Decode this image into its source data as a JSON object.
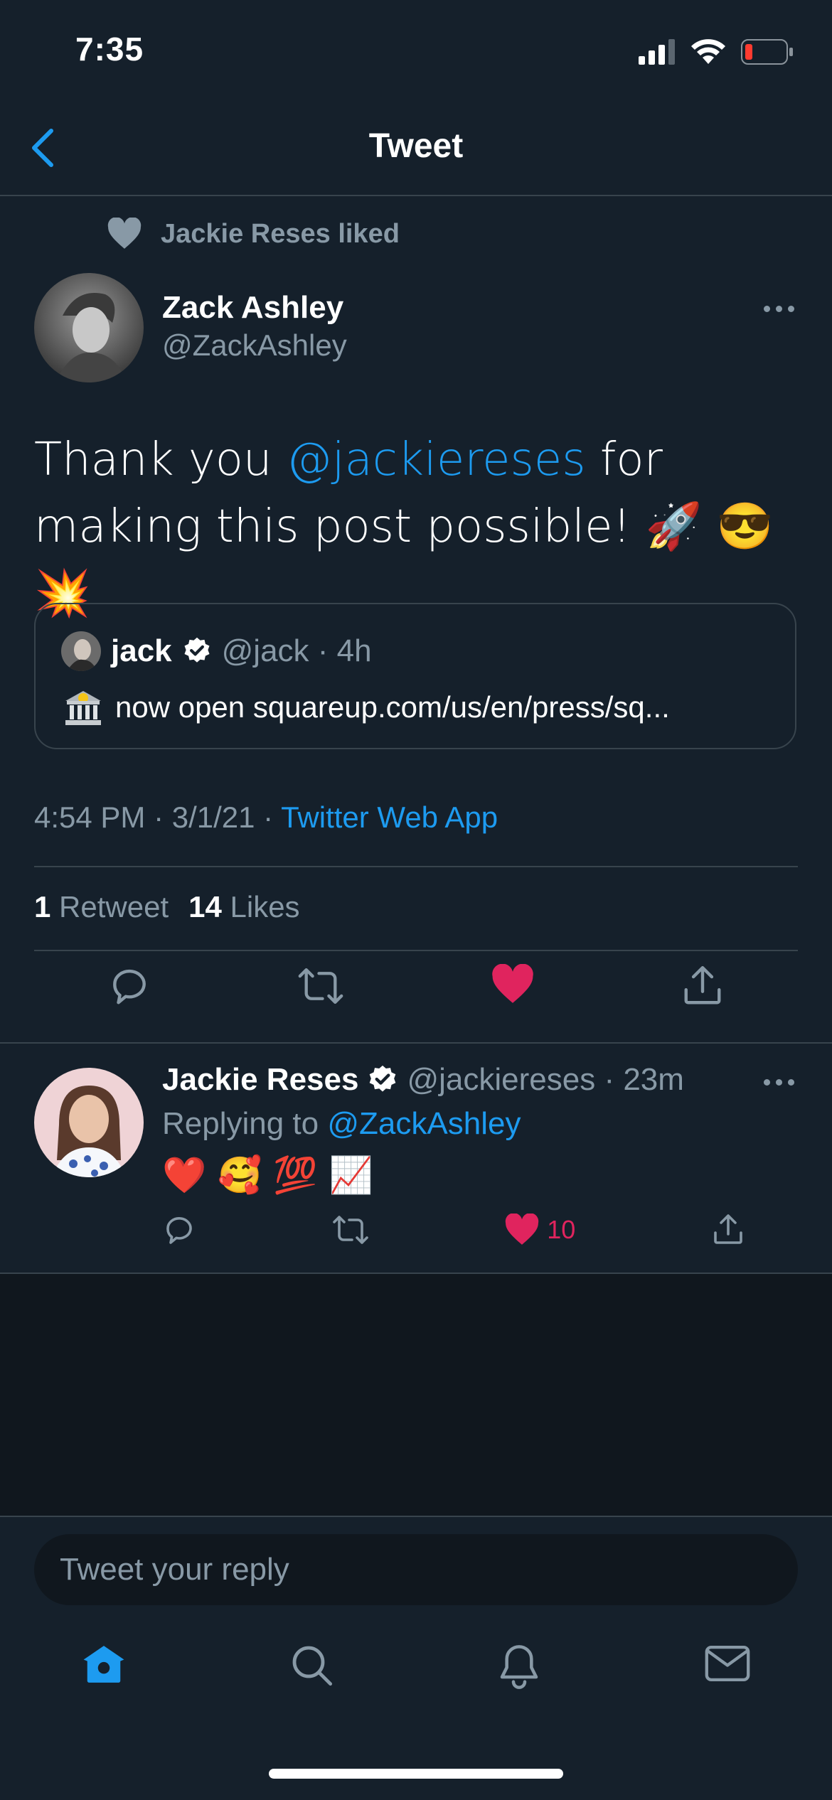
{
  "status_bar": {
    "time": "7:35"
  },
  "header": {
    "title": "Tweet",
    "back_icon": "chevron-left-icon"
  },
  "social_context": {
    "text": "Jackie Reses liked",
    "icon": "heart-icon"
  },
  "tweet": {
    "author_name": "Zack Ashley",
    "author_handle": "@ZackAshley",
    "text_before": "Thank you ",
    "mention": "@jackiereses",
    "text_after": " for making this post possible! 🚀 😎 💥",
    "timestamp": "4:54 PM · 3/1/21 · ",
    "source": "Twitter Web App",
    "retweets_count": "1",
    "retweets_label": "Retweet",
    "likes_count": "14",
    "likes_label": "Likes"
  },
  "quote": {
    "name": "jack",
    "handle_time": "@jack · 4h",
    "text": "now open squareup.com/us/en/press/sq..."
  },
  "reply": {
    "name": "Jackie Reses",
    "handle_time": "@jackiereses · 23m",
    "replying_prefix": "Replying to ",
    "replying_to": "@ZackAshley",
    "emojis": "❤️ 🥰 💯 📈",
    "likes": "10"
  },
  "composer": {
    "placeholder": "Tweet your reply"
  },
  "tabbar": {
    "items": [
      "home-icon",
      "search-icon",
      "bell-icon",
      "mail-icon"
    ]
  },
  "colors": {
    "background": "#15202b",
    "accent": "#1d9bf0",
    "like": "#e0245e",
    "muted": "#8899a6"
  }
}
